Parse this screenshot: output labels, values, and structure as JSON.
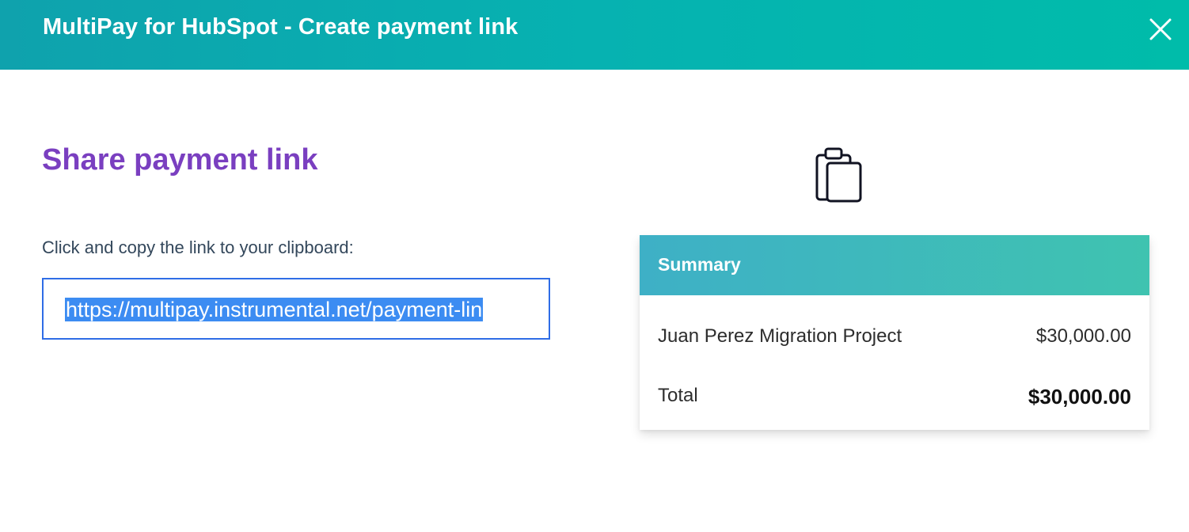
{
  "header": {
    "title": "MultiPay for HubSpot - Create payment link",
    "close_icon": "close-icon"
  },
  "share": {
    "heading": "Share payment link",
    "instruction": "Click and copy the link to your clipboard:",
    "link_value": "https://multipay.instrumental.net/payment-lin",
    "copy_icon": "clipboard-icon"
  },
  "summary": {
    "title": "Summary",
    "items": [
      {
        "label": "Juan Perez Migration Project",
        "amount": "$30,000.00"
      }
    ],
    "total_label": "Total",
    "total_amount": "$30,000.00"
  },
  "colors": {
    "header_gradient_start": "#0fa2ad",
    "header_gradient_end": "#00bcaa",
    "heading_purple": "#7a3fc0",
    "link_border": "#2f6de6",
    "selection_highlight": "#3c8cf2",
    "summary_gradient_start": "#3eb0c6",
    "summary_gradient_end": "#3fc3b0"
  }
}
